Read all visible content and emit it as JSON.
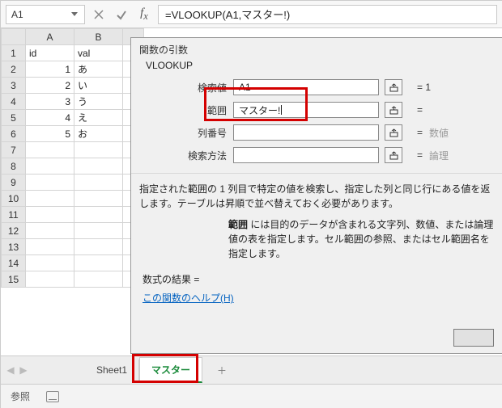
{
  "topbar": {
    "namebox": "A1",
    "formula": "=VLOOKUP(A1,マスター!)"
  },
  "columns": [
    "A",
    "B"
  ],
  "rows": [
    "1",
    "2",
    "3",
    "4",
    "5",
    "6",
    "7",
    "8",
    "9",
    "10",
    "11",
    "12",
    "13",
    "14",
    "15"
  ],
  "cells": {
    "A1": "id",
    "B1": "val",
    "A2": "1",
    "B2": "あ",
    "A3": "2",
    "B3": "い",
    "A4": "3",
    "B4": "う",
    "A5": "4",
    "B5": "え",
    "A6": "5",
    "B6": "お"
  },
  "sheettabs": {
    "tab1": "Sheet1",
    "tab2": "マスター"
  },
  "status": {
    "mode": "参照"
  },
  "dialog": {
    "title": "関数の引数",
    "function": "VLOOKUP",
    "args": {
      "lookup_value": {
        "label": "検索値",
        "value": "A1",
        "result": "= 1"
      },
      "table_array": {
        "label": "範囲",
        "value": "マスター!",
        "result": "="
      },
      "col_index": {
        "label": "列番号",
        "value": "",
        "result_eq": "=",
        "hint": "数値"
      },
      "range_lookup": {
        "label": "検索方法",
        "value": "",
        "result_eq": "=",
        "hint": "論理"
      }
    },
    "desc1": "指定された範囲の 1 列目で特定の値を検索し、指定した列と同じ行にある値を返します。テーブルは昇順で並べ替えておく必要があります。",
    "desc2_label": "範囲",
    "desc2": "には目的のデータが含まれる文字列、数値、または論理値の表を指定します。セル範囲の参照、またはセル範囲名を指定します。",
    "result": "数式の結果 =",
    "helplink": "この関数のヘルプ(H)"
  }
}
